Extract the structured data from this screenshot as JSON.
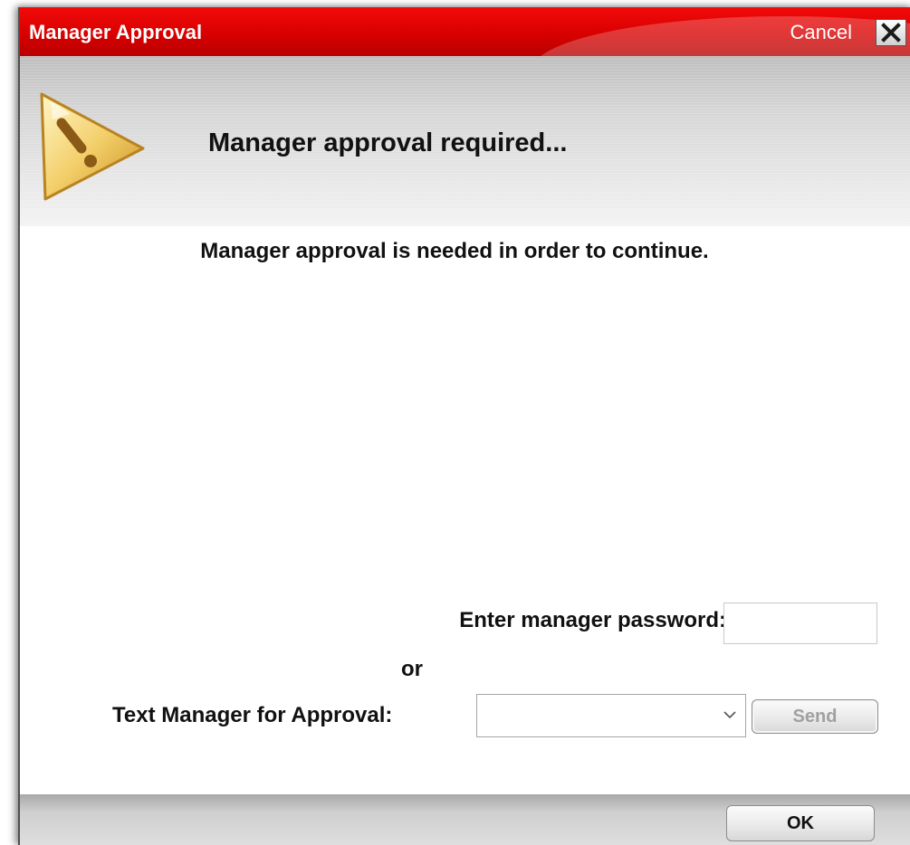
{
  "dialog": {
    "title": "Manager Approval",
    "cancel_label": "Cancel",
    "close_label": "X",
    "header_title": "Manager approval required...",
    "message": "Manager approval is needed in order to continue."
  },
  "form": {
    "password_label": "Enter manager password:",
    "password_value": "",
    "or_label": "or",
    "text_label": "Text Manager for Approval:",
    "text_selected_value": "",
    "send_label": "Send",
    "send_enabled": false
  },
  "footer": {
    "ok_label": "OK"
  },
  "icons": {
    "warning": "warning-icon",
    "close": "close-icon",
    "dropdown": "chevron-down-icon"
  },
  "colors": {
    "title_bar": "#d80000",
    "title_text": "#ffffff",
    "disabled_text": "#a0a0a0"
  }
}
